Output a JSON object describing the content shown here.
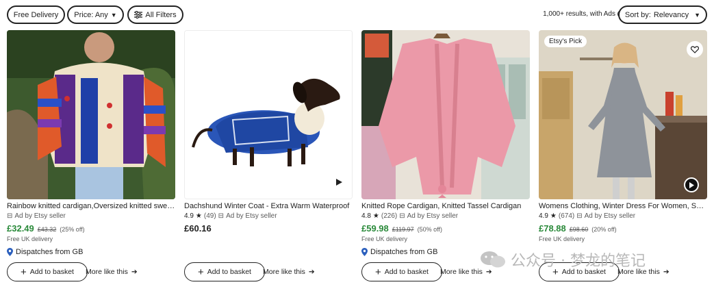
{
  "filters": {
    "free_delivery": "Free Delivery",
    "price": "Price: Any",
    "all_filters": "All Filters"
  },
  "results_text": "1,000+ results, with Ads",
  "sort": {
    "label": "Sort by:",
    "value": "Relevancy"
  },
  "products": [
    {
      "title": "Rainbow knitted cardigan,Oversized knitted sweater",
      "ad": "Ad by Etsy seller",
      "price": "£32.49",
      "old_price": "£43.32",
      "discount": "(25% off)",
      "delivery": "Free UK delivery",
      "dispatch": "Dispatches from GB",
      "basket": "Add to basket",
      "more": "More like this"
    },
    {
      "title": "Dachshund Winter Coat - Extra Warm Waterproof",
      "rating": "4.9",
      "reviews": "(49)",
      "ad": "Ad by Etsy seller",
      "price": "£60.16",
      "basket": "Add to basket",
      "more": "More like this"
    },
    {
      "title": "Knitted Rope Cardigan, Knitted Tassel Cardigan",
      "rating": "4.8",
      "reviews": "(226)",
      "ad": "Ad by Etsy seller",
      "price": "£59.98",
      "old_price": "£119.97",
      "discount": "(50% off)",
      "delivery": "Free UK delivery",
      "dispatch": "Dispatches from GB",
      "basket": "Add to basket",
      "more": "More like this"
    },
    {
      "badge": "Etsy's Pick",
      "title": "Womens Clothing, Winter Dress For Women, Sweater",
      "rating": "4.9",
      "reviews": "(674)",
      "ad": "Ad by Etsy seller",
      "price": "£78.88",
      "old_price": "£98.60",
      "discount": "(20% off)",
      "delivery": "Free UK delivery",
      "basket": "Add to basket",
      "more": "More like this"
    }
  ],
  "watermark": "公众号 · 梦龙的笔记",
  "colors": {
    "sale_price": "#2a8a3a",
    "text": "#222222",
    "muted": "#595959"
  }
}
